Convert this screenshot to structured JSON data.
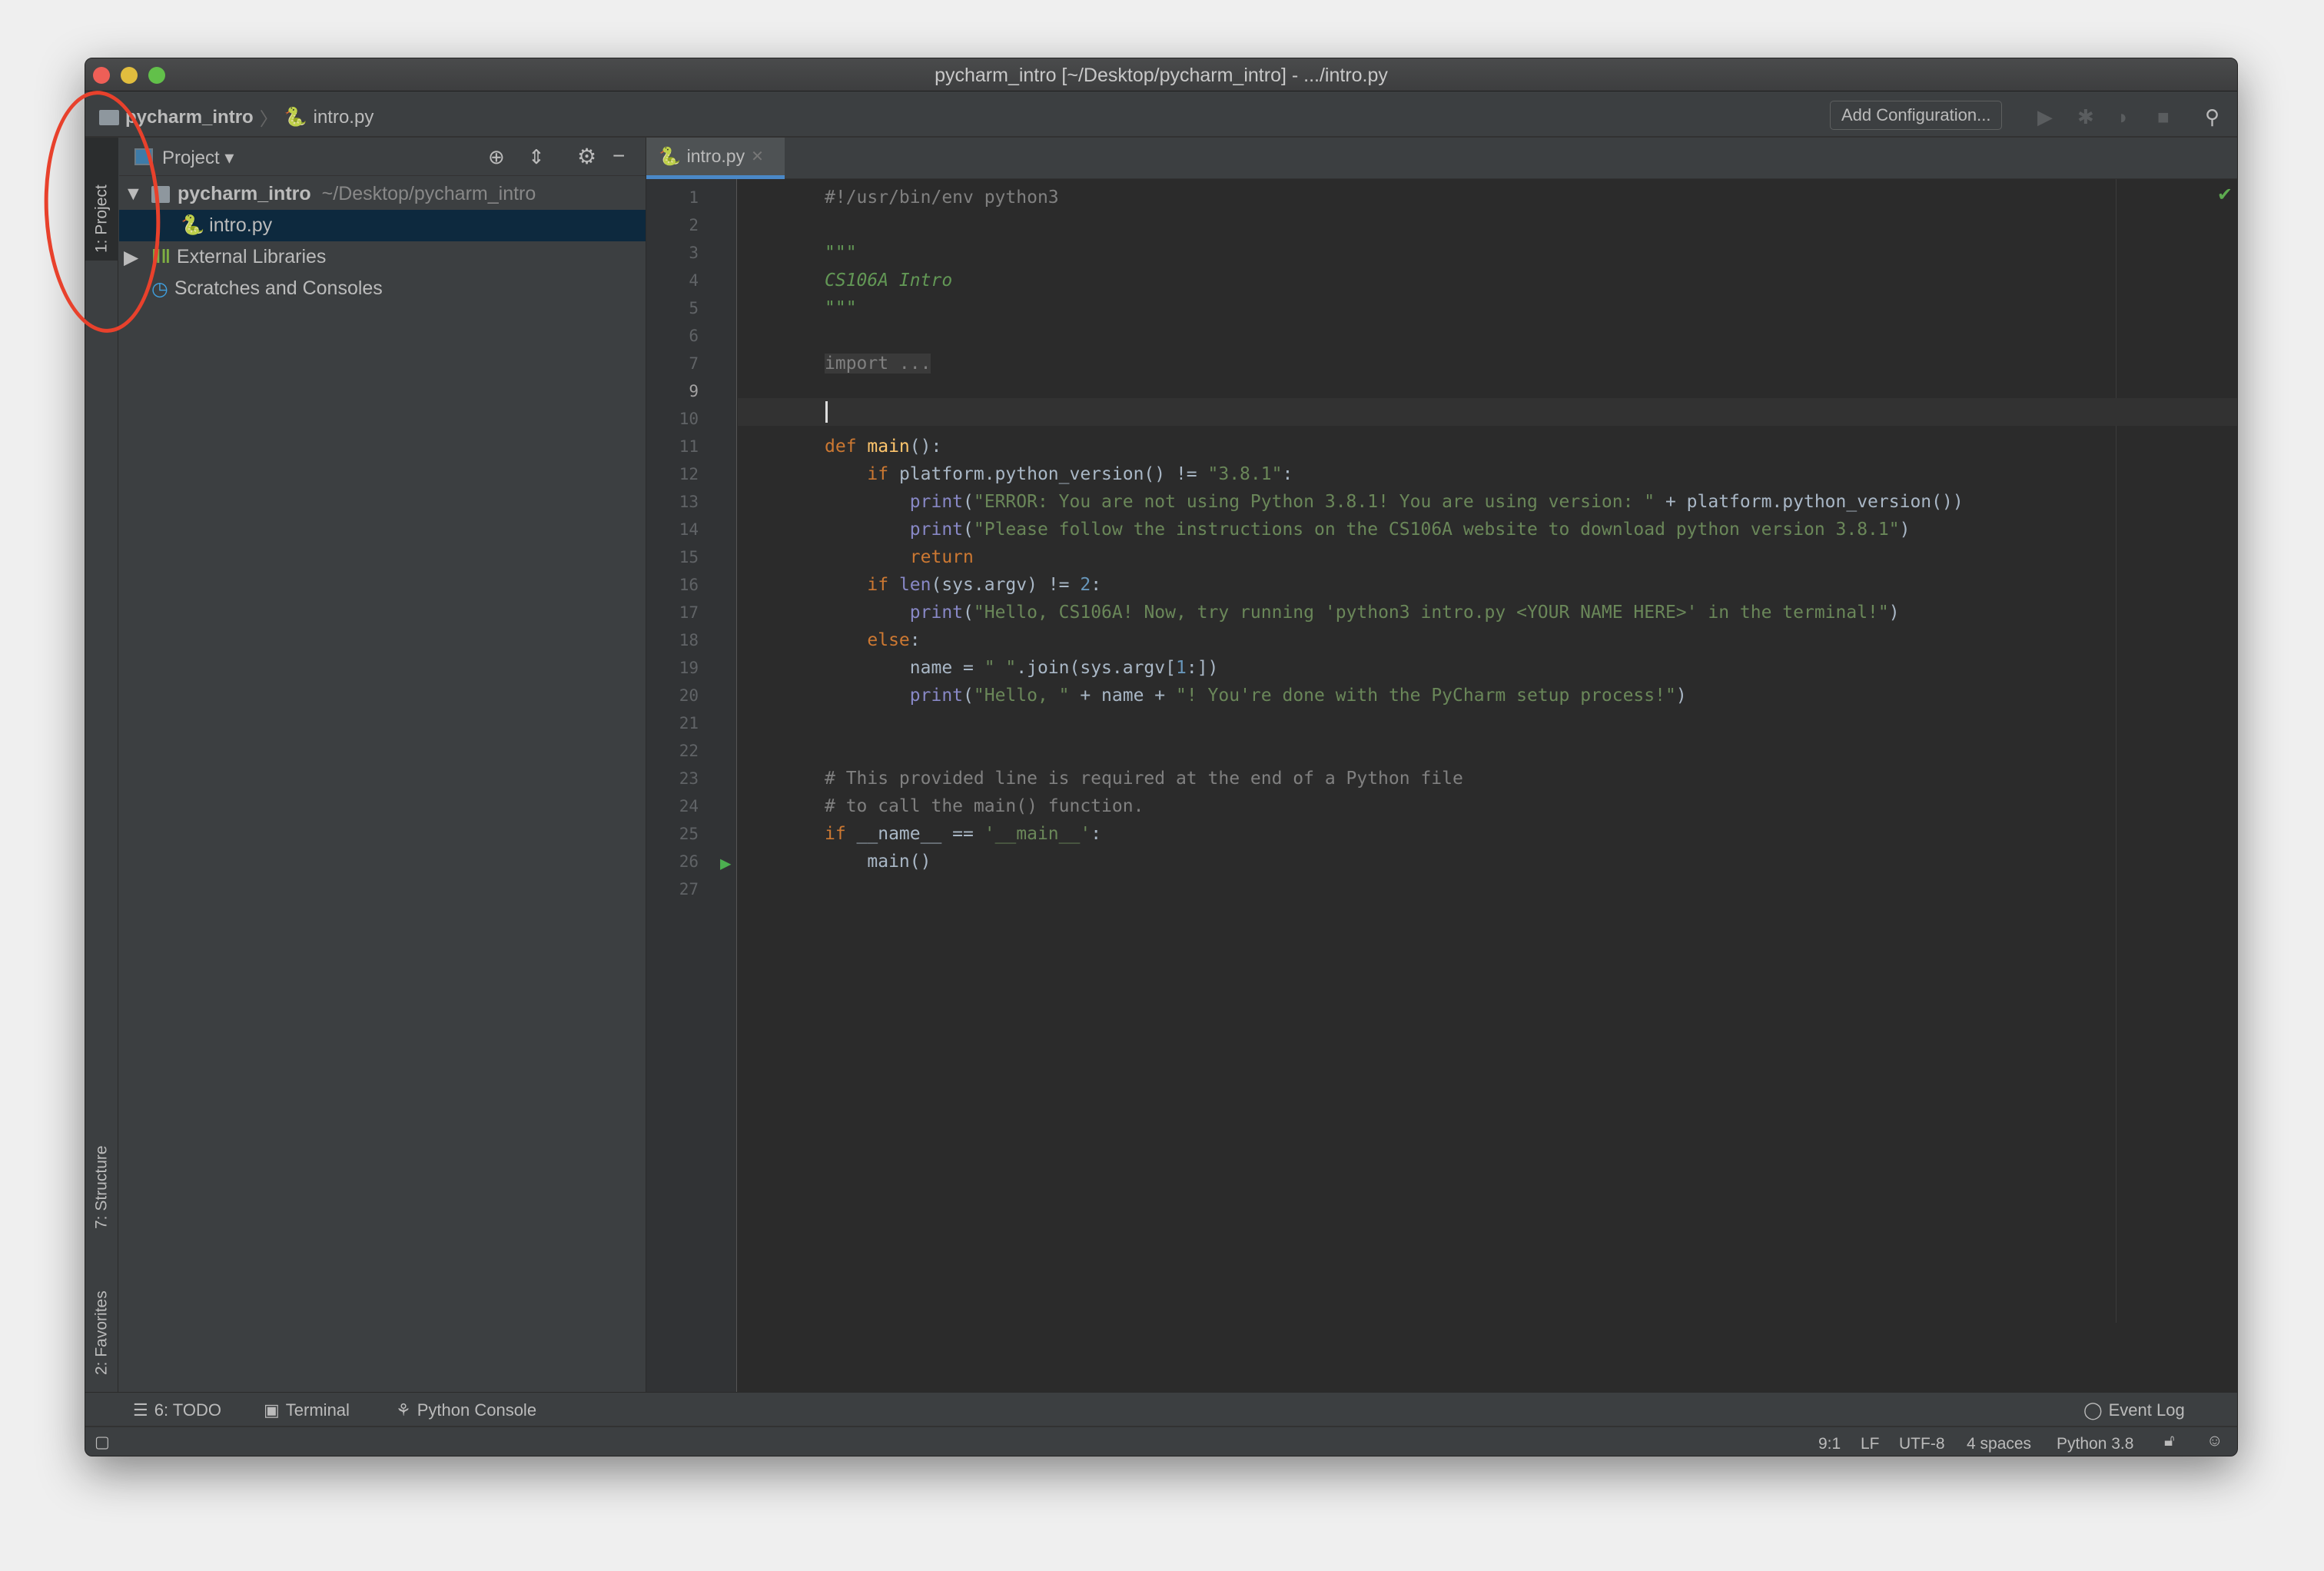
{
  "window": {
    "title": "pycharm_intro [~/Desktop/pycharm_intro] - .../intro.py"
  },
  "navbar": {
    "breadcrumb": [
      "pycharm_intro",
      "intro.py"
    ],
    "add_configuration": "Add Configuration...",
    "icons": [
      "run-icon",
      "debug-icon",
      "coverage-icon",
      "stop-icon",
      "search-icon"
    ]
  },
  "left_stripe": {
    "project_tab": "1: Project",
    "structure_tab": "7: Structure",
    "favorites_tab": "2: Favorites"
  },
  "project_panel": {
    "header": "Project",
    "tree": [
      {
        "label": "pycharm_intro",
        "path": "~/Desktop/pycharm_intro",
        "expanded": true
      },
      {
        "label": "intro.py",
        "selected": true
      },
      {
        "label": "External Libraries",
        "expanded": false
      },
      {
        "label": "Scratches and Consoles"
      }
    ]
  },
  "editor": {
    "tab": "intro.py",
    "current_line": 9,
    "lines": [
      [
        [
          "#!/usr/bin/env python3",
          "cmt"
        ]
      ],
      [],
      [
        [
          "\"\"\"",
          "doc"
        ]
      ],
      [
        [
          "CS106A Intro",
          "doc"
        ]
      ],
      [
        [
          "\"\"\"",
          "doc"
        ]
      ],
      [],
      [
        [
          "import ...",
          "fold"
        ]
      ],
      [],
      [],
      [
        [
          "def ",
          "kw"
        ],
        [
          "main",
          "fn"
        ],
        [
          "():",
          ""
        ]
      ],
      [
        [
          "    ",
          ""
        ],
        [
          "if ",
          "kw"
        ],
        [
          "platform.python_version() != ",
          ""
        ],
        [
          "\"3.8.1\"",
          "str"
        ],
        [
          ":",
          ""
        ]
      ],
      [
        [
          "        ",
          ""
        ],
        [
          "print",
          "bi"
        ],
        [
          "(",
          ""
        ],
        [
          "\"ERROR: You are not using Python 3.8.1! You are using version: \"",
          "str"
        ],
        [
          " + platform.python_version())",
          ""
        ]
      ],
      [
        [
          "        ",
          ""
        ],
        [
          "print",
          "bi"
        ],
        [
          "(",
          ""
        ],
        [
          "\"Please follow the instructions on the CS106A website to download python version 3.8.1\"",
          "str"
        ],
        [
          ")",
          ""
        ]
      ],
      [
        [
          "        ",
          ""
        ],
        [
          "return",
          "kw"
        ]
      ],
      [
        [
          "    ",
          ""
        ],
        [
          "if ",
          "kw"
        ],
        [
          "len",
          "bi"
        ],
        [
          "(sys.argv) != ",
          ""
        ],
        [
          "2",
          "num"
        ],
        [
          ":",
          ""
        ]
      ],
      [
        [
          "        ",
          ""
        ],
        [
          "print",
          "bi"
        ],
        [
          "(",
          ""
        ],
        [
          "\"Hello, CS106A! Now, try running 'python3 intro.py <YOUR NAME HERE>' in the terminal!\"",
          "str"
        ],
        [
          ")",
          ""
        ]
      ],
      [
        [
          "    ",
          ""
        ],
        [
          "else",
          "kw"
        ],
        [
          ":",
          ""
        ]
      ],
      [
        [
          "        name = ",
          ""
        ],
        [
          "\" \"",
          "str"
        ],
        [
          ".join(sys.argv[",
          ""
        ],
        [
          "1",
          "num"
        ],
        [
          ":])",
          ""
        ]
      ],
      [
        [
          "        ",
          ""
        ],
        [
          "print",
          "bi"
        ],
        [
          "(",
          ""
        ],
        [
          "\"Hello, \"",
          "str"
        ],
        [
          " + name + ",
          ""
        ],
        [
          "\"! You're done with the PyCharm setup process!\"",
          "str"
        ],
        [
          ")",
          ""
        ]
      ],
      [],
      [],
      [
        [
          "# This provided line is required at the end of a Python file",
          "cmt"
        ]
      ],
      [
        [
          "# to call the main() function.",
          "cmt"
        ]
      ],
      [
        [
          "if ",
          "kw"
        ],
        [
          "__name__ == ",
          ""
        ],
        [
          "'__main__'",
          "str"
        ],
        [
          ":",
          ""
        ]
      ],
      [
        [
          "    main()",
          ""
        ]
      ],
      []
    ]
  },
  "bottom_tools": {
    "todo": "6: TODO",
    "terminal": "Terminal",
    "python_console": "Python Console",
    "event_log": "Event Log"
  },
  "status": {
    "position": "9:1",
    "line_sep": "LF",
    "encoding": "UTF-8",
    "indent": "4 spaces",
    "interpreter": "Python 3.8"
  },
  "colors": {
    "keyword": "#cc7832",
    "string": "#6a8759",
    "comment": "#808080",
    "selection": "#0d293e",
    "accent": "#4a88c7",
    "annotation_circle": "#e8412c"
  }
}
